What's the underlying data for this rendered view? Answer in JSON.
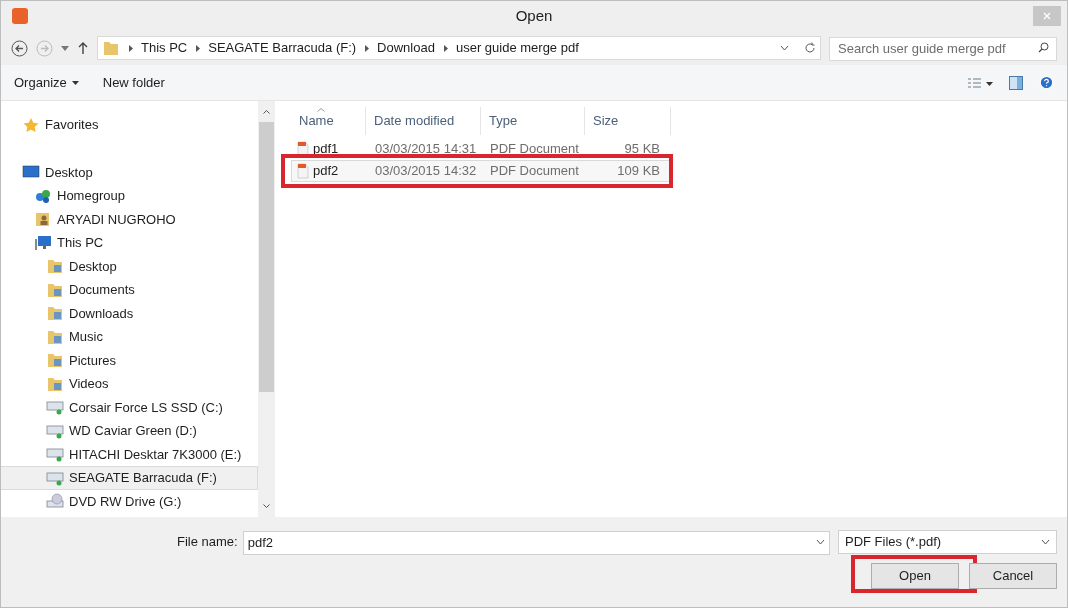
{
  "window": {
    "title": "Open"
  },
  "address_bar": {
    "segments": [
      "This PC",
      "SEAGATE Barracuda (F:)",
      "Download",
      "user guide merge pdf"
    ]
  },
  "search": {
    "placeholder": "Search user guide merge pdf"
  },
  "toolbar": {
    "organize": "Organize",
    "new_folder": "New folder"
  },
  "sidebar": {
    "items": [
      {
        "label": "Favorites",
        "kind": "star",
        "selected": false
      },
      {
        "label": "Desktop",
        "kind": "monitor",
        "selected": false,
        "children": [
          {
            "label": "Homegroup",
            "kind": "homegroup",
            "selected": false
          },
          {
            "label": "ARYADI NUGROHO",
            "kind": "user",
            "selected": false
          },
          {
            "label": "This PC",
            "kind": "pc",
            "selected": false,
            "children": [
              {
                "label": "Desktop",
                "kind": "folder",
                "selected": false
              },
              {
                "label": "Documents",
                "kind": "folder",
                "selected": false
              },
              {
                "label": "Downloads",
                "kind": "folder",
                "selected": false
              },
              {
                "label": "Music",
                "kind": "folder",
                "selected": false
              },
              {
                "label": "Pictures",
                "kind": "folder",
                "selected": false
              },
              {
                "label": "Videos",
                "kind": "folder",
                "selected": false
              },
              {
                "label": "Corsair Force LS SSD (C:)",
                "kind": "drive",
                "selected": false
              },
              {
                "label": "WD Caviar Green (D:)",
                "kind": "drive",
                "selected": false
              },
              {
                "label": "HITACHI Desktar 7K3000 (E:)",
                "kind": "drive",
                "selected": false
              },
              {
                "label": "SEAGATE Barracuda (F:)",
                "kind": "drive",
                "selected": true
              },
              {
                "label": "DVD RW Drive (G:)",
                "kind": "dvd",
                "selected": false
              }
            ]
          }
        ]
      }
    ]
  },
  "file_list": {
    "columns": [
      "Name",
      "Date modified",
      "Type",
      "Size"
    ],
    "rows": [
      {
        "name": "pdf1",
        "date": "03/03/2015 14:31",
        "type": "PDF Document",
        "size": "95 KB",
        "selected": false,
        "highlighted": false
      },
      {
        "name": "pdf2",
        "date": "03/03/2015 14:32",
        "type": "PDF Document",
        "size": "109 KB",
        "selected": true,
        "highlighted": true
      }
    ]
  },
  "file_name": {
    "label": "File name:",
    "value": "pdf2"
  },
  "file_type": {
    "value": "PDF Files (*.pdf)"
  },
  "buttons": [
    {
      "label": "Open",
      "highlighted": true
    },
    {
      "label": "Cancel",
      "highlighted": false
    }
  ]
}
